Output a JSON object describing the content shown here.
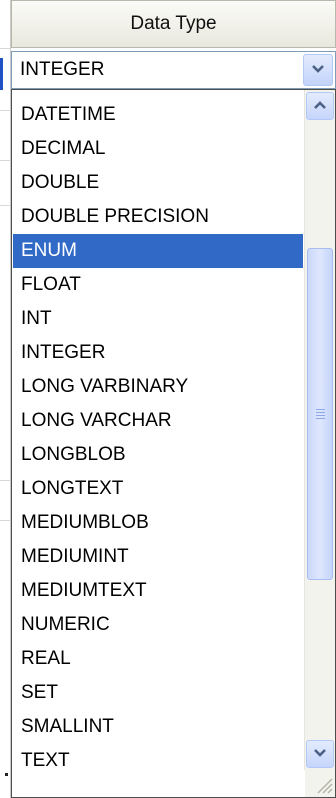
{
  "column_header": "Data Type",
  "combo": {
    "value": "INTEGER",
    "dropdown_button_icon": "chevron-down-icon"
  },
  "dropdown": {
    "selected": "ENUM",
    "items": [
      "DATETIME",
      "DECIMAL",
      "DOUBLE",
      "DOUBLE PRECISION",
      "ENUM",
      "FLOAT",
      "INT",
      "INTEGER",
      "LONG VARBINARY",
      "LONG VARCHAR",
      "LONGBLOB",
      "LONGTEXT",
      "MEDIUMBLOB",
      "MEDIUMINT",
      "MEDIUMTEXT",
      "NUMERIC",
      "REAL",
      "SET",
      "SMALLINT",
      "TEXT"
    ]
  },
  "scrollbar": {
    "up_icon": "chevron-up-icon",
    "down_icon": "chevron-down-icon"
  },
  "colors": {
    "selection": "#3169c6",
    "combo_border": "#7f9db9",
    "scroll_button": "#c5d5fb"
  }
}
